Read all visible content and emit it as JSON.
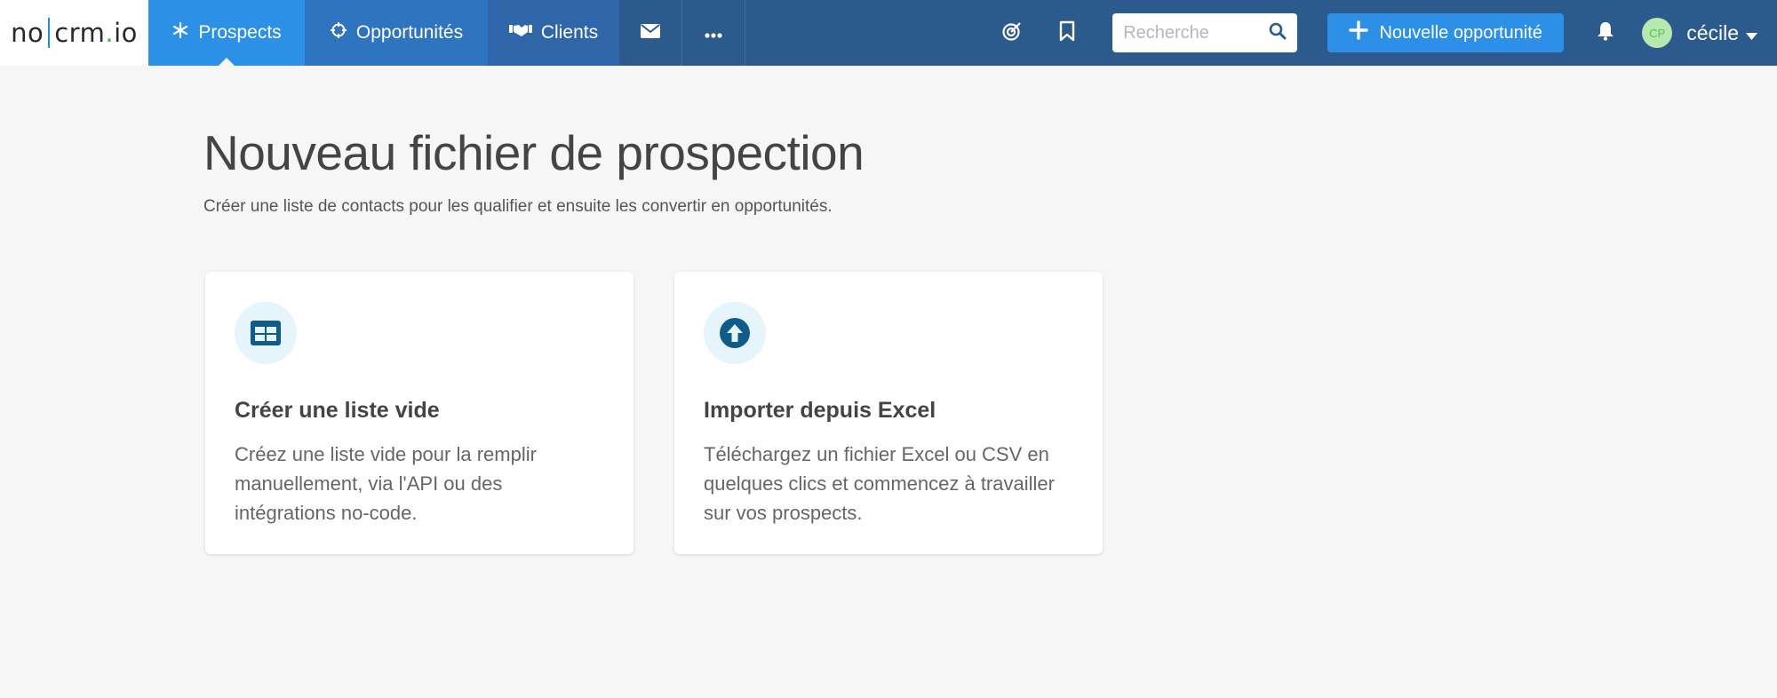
{
  "app": {
    "logo": {
      "part1": "no",
      "part2": "crm",
      "dot": ".",
      "part3": "io"
    }
  },
  "nav": {
    "items": [
      {
        "label": "Prospects",
        "icon": "snowflake-icon",
        "active": true
      },
      {
        "label": "Opportunités",
        "icon": "crosshair-icon",
        "active": false
      },
      {
        "label": "Clients",
        "icon": "handshake-icon",
        "active": false
      }
    ],
    "mail_icon": "envelope-icon",
    "more_icon": "ellipsis-icon"
  },
  "header": {
    "target_icon": "target-icon",
    "bookmark_icon": "bookmark-icon",
    "search": {
      "placeholder": "Recherche",
      "value": ""
    },
    "new_button_label": "Nouvelle opportunité",
    "bell_icon": "bell-icon",
    "avatar_initials": "CP",
    "user_name": "cécile"
  },
  "page": {
    "title": "Nouveau fichier de prospection",
    "subtitle": "Créer une liste de contacts pour les qualifier et ensuite les convertir en opportunités."
  },
  "cards": [
    {
      "icon": "table-icon",
      "title": "Créer une liste vide",
      "description": "Créez une liste vide pour la remplir manuellement, via l'API ou des intégrations no-code."
    },
    {
      "icon": "upload-circle-icon",
      "title": "Importer depuis Excel",
      "description": "Téléchargez un fichier Excel ou CSV en quelques clics et commencez à travailler sur vos prospects."
    }
  ],
  "colors": {
    "topbar": "#2d5a8c",
    "active_tab": "#2b90e6",
    "primary_button": "#2b90e6",
    "icon_accent": "#0f5c8a",
    "background": "#f6f6f6"
  }
}
